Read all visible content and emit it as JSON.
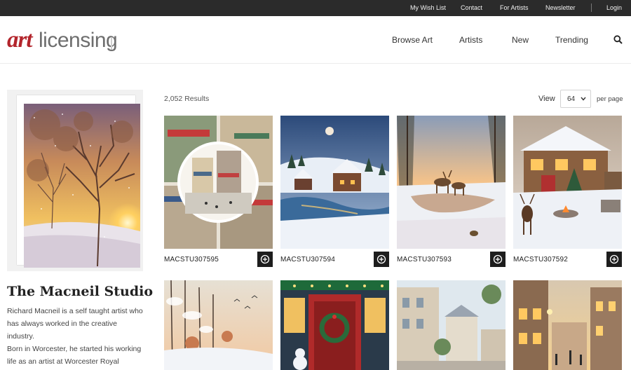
{
  "topbar": {
    "links": [
      "My Wish List",
      "Contact",
      "For Artists",
      "Newsletter"
    ],
    "login": "Login"
  },
  "logo": {
    "art": "art",
    "rest": "licensing"
  },
  "nav": {
    "items": [
      "Browse Art",
      "Artists",
      "New",
      "Trending"
    ],
    "search_icon": "search-icon"
  },
  "sidebar": {
    "studio_name": "The Macneil Studio",
    "bio_lines": [
      "Richard Macneil is a self taught artist who",
      "has always worked in the creative",
      "industry.",
      "Born in Worcester, he started his working",
      "life as an artist at Worcester Royal"
    ]
  },
  "results": {
    "count_text": "2,052 Results",
    "view_label": "View",
    "per_page_value": "64",
    "per_page_label": "per page"
  },
  "artworks": [
    {
      "code": "MACSTU307595",
      "scene": "village-street-vignette"
    },
    {
      "code": "MACSTU307594",
      "scene": "snowy-village-river"
    },
    {
      "code": "MACSTU307593",
      "scene": "deer-sunset-lake"
    },
    {
      "code": "MACSTU307592",
      "scene": "cottage-stag-fire"
    },
    {
      "code": "",
      "scene": "winter-forest-birds"
    },
    {
      "code": "",
      "scene": "christmas-door"
    },
    {
      "code": "",
      "scene": "paris-street-day"
    },
    {
      "code": "",
      "scene": "evening-street-lights"
    }
  ],
  "colors": {
    "topbar_bg": "#2b2b2b",
    "brand_red": "#b3252c",
    "logo_gray": "#6e6e6e",
    "add_button_bg": "#1d1d1d"
  }
}
